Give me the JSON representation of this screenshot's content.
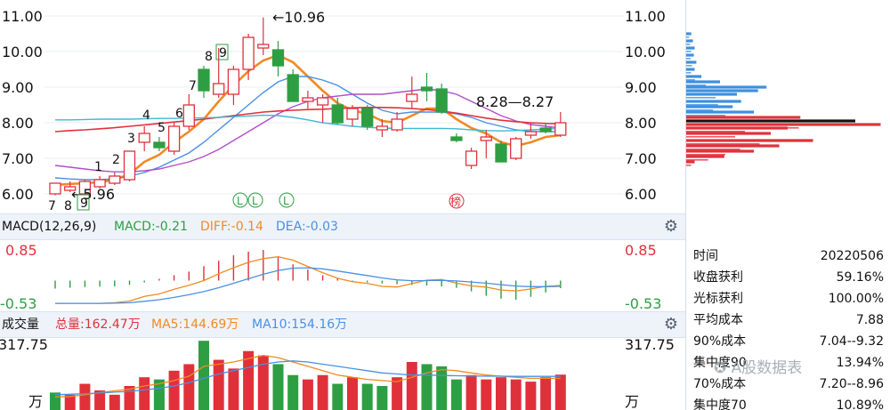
{
  "price_panel": {
    "y_axis_ticks": [
      "11.00",
      "10.00",
      "9.00",
      "8.00",
      "7.00",
      "6.00"
    ],
    "high_marker": "←10.96",
    "low_marker": "←5.96",
    "range_label": "8.28—8.27",
    "count_labels": [
      "7",
      "8",
      "9",
      "1",
      "2",
      "3",
      "4",
      "5",
      "6",
      "7",
      "8",
      "9"
    ],
    "l_badges": [
      "L",
      "L",
      "L"
    ],
    "bang_badge": "榜"
  },
  "macd_header": {
    "title": "MACD(12,26,9)",
    "macd": "MACD:-0.21",
    "diff": "DIFF:-0.14",
    "dea": "DEA:-0.03"
  },
  "macd_axis": {
    "top": "0.85",
    "bottom": "-0.53"
  },
  "volume_header": {
    "title": "成交量",
    "total": "总量:162.47万",
    "ma5": "MA5:144.69万",
    "ma10": "MA10:154.16万"
  },
  "volume_axis": {
    "top": "317.75",
    "unit": "万"
  },
  "info_panel": [
    {
      "label": "时间",
      "value": "20220506"
    },
    {
      "label": "收盘获利",
      "value": "59.16%"
    },
    {
      "label": "光标获利",
      "value": "100.00%"
    },
    {
      "label": "平均成本",
      "value": "7.88"
    },
    {
      "label": "90%成本",
      "value": "7.04--9.32"
    },
    {
      "label": "集中度90",
      "value": "13.94%"
    },
    {
      "label": "70%成本",
      "value": "7.20--8.96"
    },
    {
      "label": "集中度70",
      "value": "10.89%"
    }
  ],
  "watermark": "A股数据表",
  "colors": {
    "up": "#e0313b",
    "down": "#2e9e43",
    "ma5": "#f08a24",
    "ma10": "#4a90e2",
    "ma20": "#b04fc9",
    "ma30": "#e0313b",
    "ma60": "#3fb9d4",
    "strip_bg": "#eef3fa"
  },
  "chart_data": {
    "type": "candlestick",
    "candles": [
      {
        "o": 6.0,
        "h": 6.3,
        "l": 5.96,
        "c": 6.3
      },
      {
        "o": 6.1,
        "h": 6.35,
        "l": 6.05,
        "c": 6.2
      },
      {
        "o": 6.0,
        "h": 6.4,
        "l": 5.96,
        "c": 6.35
      },
      {
        "o": 6.2,
        "h": 6.5,
        "l": 6.15,
        "c": 6.4
      },
      {
        "o": 6.3,
        "h": 6.6,
        "l": 6.25,
        "c": 6.5
      },
      {
        "o": 6.4,
        "h": 7.2,
        "l": 6.35,
        "c": 7.2
      },
      {
        "o": 7.45,
        "h": 7.9,
        "l": 7.2,
        "c": 7.7
      },
      {
        "o": 7.45,
        "h": 7.6,
        "l": 7.2,
        "c": 7.3
      },
      {
        "o": 7.2,
        "h": 8.0,
        "l": 7.1,
        "c": 7.9
      },
      {
        "o": 7.9,
        "h": 8.8,
        "l": 7.8,
        "c": 8.5
      },
      {
        "o": 9.5,
        "h": 9.6,
        "l": 8.7,
        "c": 8.9
      },
      {
        "o": 8.8,
        "h": 10.1,
        "l": 8.7,
        "c": 9.1
      },
      {
        "o": 8.8,
        "h": 9.6,
        "l": 8.5,
        "c": 9.5
      },
      {
        "o": 9.5,
        "h": 10.5,
        "l": 9.2,
        "c": 10.4
      },
      {
        "o": 10.1,
        "h": 10.96,
        "l": 9.9,
        "c": 10.2
      },
      {
        "o": 10.05,
        "h": 10.3,
        "l": 9.3,
        "c": 9.6
      },
      {
        "o": 9.35,
        "h": 9.5,
        "l": 8.6,
        "c": 8.6
      },
      {
        "o": 8.6,
        "h": 8.9,
        "l": 8.4,
        "c": 8.7
      },
      {
        "o": 8.5,
        "h": 8.8,
        "l": 8.0,
        "c": 8.7
      },
      {
        "o": 8.5,
        "h": 8.7,
        "l": 7.95,
        "c": 8.0
      },
      {
        "o": 8.1,
        "h": 8.5,
        "l": 7.9,
        "c": 8.4
      },
      {
        "o": 8.4,
        "h": 8.5,
        "l": 7.8,
        "c": 7.9
      },
      {
        "o": 7.8,
        "h": 8.1,
        "l": 7.6,
        "c": 7.9
      },
      {
        "o": 7.8,
        "h": 8.3,
        "l": 7.75,
        "c": 8.1
      },
      {
        "o": 8.6,
        "h": 9.3,
        "l": 8.4,
        "c": 8.8
      },
      {
        "o": 9.0,
        "h": 9.4,
        "l": 8.6,
        "c": 8.9
      },
      {
        "o": 8.95,
        "h": 9.1,
        "l": 8.25,
        "c": 8.3
      },
      {
        "o": 7.6,
        "h": 7.7,
        "l": 7.45,
        "c": 7.5
      },
      {
        "o": 6.8,
        "h": 7.3,
        "l": 6.7,
        "c": 7.2
      },
      {
        "o": 7.5,
        "h": 7.8,
        "l": 7.0,
        "c": 7.6
      },
      {
        "o": 7.4,
        "h": 7.5,
        "l": 6.9,
        "c": 6.9
      },
      {
        "o": 7.0,
        "h": 7.6,
        "l": 6.95,
        "c": 7.55
      },
      {
        "o": 7.65,
        "h": 8.0,
        "l": 7.55,
        "c": 7.75
      },
      {
        "o": 7.85,
        "h": 8.0,
        "l": 7.7,
        "c": 7.75
      },
      {
        "o": 7.65,
        "h": 8.3,
        "l": 7.6,
        "c": 8.0
      }
    ],
    "ma_lines": [
      {
        "name": "MA5",
        "values": [
          6.25,
          6.28,
          6.3,
          6.33,
          6.4,
          6.55,
          6.9,
          7.1,
          7.45,
          7.75,
          8.1,
          8.6,
          9.05,
          9.45,
          9.75,
          9.9,
          9.7,
          9.3,
          8.9,
          8.55,
          8.35,
          8.25,
          8.05,
          8.0,
          8.2,
          8.4,
          8.4,
          8.1,
          7.85,
          7.7,
          7.45,
          7.35,
          7.45,
          7.6,
          7.65
        ]
      },
      {
        "name": "MA10",
        "values": [
          6.45,
          6.42,
          6.4,
          6.4,
          6.42,
          6.5,
          6.6,
          6.75,
          6.95,
          7.15,
          7.45,
          7.8,
          8.15,
          8.5,
          8.85,
          9.15,
          9.3,
          9.3,
          9.2,
          9.05,
          8.8,
          8.55,
          8.35,
          8.25,
          8.3,
          8.3,
          8.3,
          8.25,
          8.15,
          8.0,
          7.9,
          7.8,
          7.75,
          7.75,
          7.75
        ]
      },
      {
        "name": "MA20",
        "values": [
          6.8,
          6.75,
          6.7,
          6.65,
          6.62,
          6.62,
          6.65,
          6.7,
          6.8,
          6.9,
          7.05,
          7.25,
          7.5,
          7.75,
          8.0,
          8.25,
          8.45,
          8.6,
          8.7,
          8.75,
          8.8,
          8.8,
          8.8,
          8.85,
          8.9,
          8.95,
          8.9,
          8.8,
          8.6,
          8.4,
          8.2,
          8.05,
          7.95,
          7.9,
          7.85
        ]
      },
      {
        "name": "MA30",
        "values": [
          7.75,
          7.78,
          7.8,
          7.83,
          7.86,
          7.9,
          7.94,
          7.98,
          8.02,
          8.06,
          8.1,
          8.15,
          8.2,
          8.25,
          8.3,
          8.33,
          8.35,
          8.37,
          8.38,
          8.4,
          8.42,
          8.43,
          8.43,
          8.42,
          8.4,
          8.37,
          8.33,
          8.27,
          8.2,
          8.13,
          8.07,
          8.03,
          8.0,
          7.98,
          7.97
        ]
      },
      {
        "name": "MA60",
        "values": [
          8.08,
          8.08,
          8.09,
          8.1,
          8.1,
          8.1,
          8.11,
          8.12,
          8.12,
          8.13,
          8.14,
          8.15,
          8.17,
          8.19,
          8.21,
          8.2,
          8.15,
          8.08,
          8.0,
          7.95,
          7.9,
          7.87,
          7.85,
          7.84,
          7.84,
          7.84,
          7.84,
          7.83,
          7.8,
          7.78,
          7.77,
          7.78,
          7.8,
          7.82,
          7.84
        ]
      }
    ],
    "macd_bars": [
      -0.22,
      -0.2,
      -0.18,
      -0.17,
      -0.16,
      -0.12,
      -0.05,
      0.05,
      0.15,
      0.25,
      0.4,
      0.55,
      0.7,
      0.8,
      0.85,
      0.65,
      0.45,
      0.3,
      0.15,
      0.05,
      -0.02,
      -0.05,
      -0.08,
      -0.1,
      -0.12,
      -0.14,
      -0.16,
      -0.2,
      -0.3,
      -0.42,
      -0.5,
      -0.53,
      -0.45,
      -0.33,
      -0.21
    ],
    "volume": [
      {
        "v": 80,
        "dir": "down"
      },
      {
        "v": 70,
        "dir": "up"
      },
      {
        "v": 120,
        "dir": "up"
      },
      {
        "v": 90,
        "dir": "up"
      },
      {
        "v": 70,
        "dir": "up"
      },
      {
        "v": 110,
        "dir": "up"
      },
      {
        "v": 150,
        "dir": "up"
      },
      {
        "v": 140,
        "dir": "down"
      },
      {
        "v": 180,
        "dir": "up"
      },
      {
        "v": 210,
        "dir": "up"
      },
      {
        "v": 317,
        "dir": "down"
      },
      {
        "v": 230,
        "dir": "up"
      },
      {
        "v": 190,
        "dir": "up"
      },
      {
        "v": 270,
        "dir": "up"
      },
      {
        "v": 250,
        "dir": "up"
      },
      {
        "v": 210,
        "dir": "down"
      },
      {
        "v": 160,
        "dir": "down"
      },
      {
        "v": 140,
        "dir": "up"
      },
      {
        "v": 160,
        "dir": "up"
      },
      {
        "v": 120,
        "dir": "down"
      },
      {
        "v": 150,
        "dir": "up"
      },
      {
        "v": 120,
        "dir": "down"
      },
      {
        "v": 110,
        "dir": "down"
      },
      {
        "v": 150,
        "dir": "up"
      },
      {
        "v": 220,
        "dir": "up"
      },
      {
        "v": 210,
        "dir": "down"
      },
      {
        "v": 200,
        "dir": "down"
      },
      {
        "v": 140,
        "dir": "down"
      },
      {
        "v": 160,
        "dir": "up"
      },
      {
        "v": 140,
        "dir": "up"
      },
      {
        "v": 150,
        "dir": "up"
      },
      {
        "v": 140,
        "dir": "up"
      },
      {
        "v": 130,
        "dir": "up"
      },
      {
        "v": 150,
        "dir": "up"
      },
      {
        "v": 162,
        "dir": "up"
      }
    ],
    "vol_ma5": [
      60,
      62,
      70,
      80,
      88,
      95,
      110,
      120,
      135,
      155,
      200,
      210,
      220,
      235,
      250,
      240,
      220,
      200,
      180,
      160,
      150,
      140,
      135,
      130,
      150,
      170,
      185,
      180,
      170,
      160,
      155,
      150,
      145,
      145,
      144.69
    ],
    "vol_ma10": [
      70,
      72,
      75,
      78,
      82,
      85,
      92,
      100,
      110,
      125,
      145,
      165,
      180,
      195,
      210,
      220,
      225,
      220,
      210,
      200,
      190,
      180,
      170,
      165,
      160,
      160,
      158,
      157,
      156,
      155,
      155,
      154,
      154,
      154,
      154.16
    ],
    "chip_distribution": [
      {
        "price": 10.5,
        "v": 6,
        "type": "profit"
      },
      {
        "price": 10.3,
        "v": 8,
        "type": "profit"
      },
      {
        "price": 10.1,
        "v": 10,
        "type": "profit"
      },
      {
        "price": 9.9,
        "v": 9,
        "type": "profit"
      },
      {
        "price": 9.7,
        "v": 12,
        "type": "profit"
      },
      {
        "price": 9.5,
        "v": 10,
        "type": "profit"
      },
      {
        "price": 9.3,
        "v": 18,
        "type": "profit"
      },
      {
        "price": 9.15,
        "v": 40,
        "type": "profit"
      },
      {
        "price": 9.0,
        "v": 95,
        "type": "profit"
      },
      {
        "price": 8.9,
        "v": 85,
        "type": "profit"
      },
      {
        "price": 8.8,
        "v": 60,
        "type": "profit"
      },
      {
        "price": 8.6,
        "v": 65,
        "type": "profit"
      },
      {
        "price": 8.45,
        "v": 55,
        "type": "profit"
      },
      {
        "price": 8.3,
        "v": 80,
        "type": "profit"
      },
      {
        "price": 8.15,
        "v": 135,
        "type": "loss"
      },
      {
        "price": 8.05,
        "v": 200,
        "type": "avg"
      },
      {
        "price": 7.95,
        "v": 230,
        "type": "loss"
      },
      {
        "price": 7.85,
        "v": 120,
        "type": "loss"
      },
      {
        "price": 7.7,
        "v": 100,
        "type": "loss"
      },
      {
        "price": 7.5,
        "v": 150,
        "type": "loss"
      },
      {
        "price": 7.35,
        "v": 110,
        "type": "loss"
      },
      {
        "price": 7.2,
        "v": 80,
        "type": "loss"
      },
      {
        "price": 7.05,
        "v": 45,
        "type": "loss"
      },
      {
        "price": 6.9,
        "v": 10,
        "type": "loss"
      }
    ]
  }
}
